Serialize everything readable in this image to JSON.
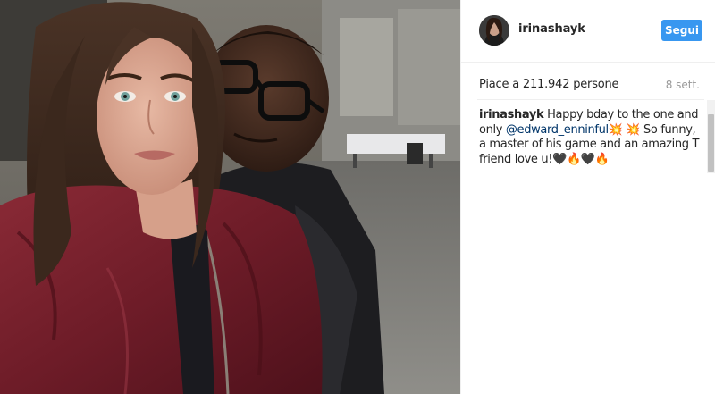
{
  "post": {
    "username": "irinashayk",
    "follow_label": "Segui",
    "likes_text": "Piace a 211.942 persone",
    "time_ago": "8 sett.",
    "caption": {
      "username": "irinashayk",
      "text_before_mention": " Happy bday to the one and only ",
      "mention": "@edward_enninful",
      "emoji_1": "💥",
      "emoji_2": "💥",
      "text_after_mention": " So funny, a master of his game and an amazing T friend love u!",
      "trailing_emojis": "🖤🔥🖤🔥"
    }
  },
  "colors": {
    "accent": "#3897f0",
    "mention": "#003569",
    "muted": "#999999"
  },
  "icons": {
    "avatar": "profile-avatar"
  }
}
